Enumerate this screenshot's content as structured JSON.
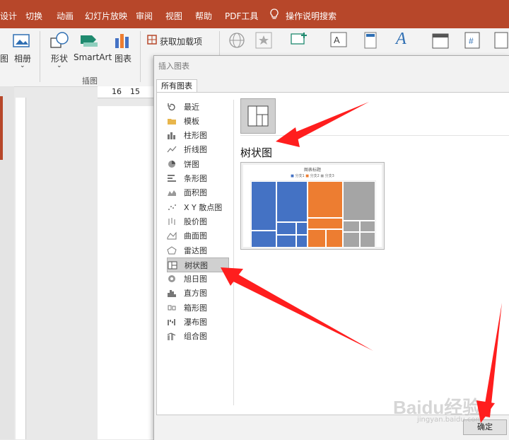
{
  "menubar": {
    "items": [
      "设计",
      "切换",
      "动画",
      "幻灯片放映",
      "审阅",
      "视图",
      "帮助",
      "PDF工具",
      "操作说明搜索"
    ]
  },
  "ribbon": {
    "buttons": {
      "images_partial": "图",
      "album": "相册",
      "shapes": "形状",
      "smartart": "SmartArt",
      "chart": "图表",
      "get_addins": "获取加载项"
    },
    "group_label": "插图"
  },
  "ruler": {
    "top_numbers": [
      "16",
      "15"
    ]
  },
  "dialog": {
    "title": "插入图表",
    "tab": "所有图表",
    "chart_types": [
      {
        "label": "最近",
        "icon": "recent-icon"
      },
      {
        "label": "模板",
        "icon": "folder-icon"
      },
      {
        "label": "柱形图",
        "icon": "column-chart-icon"
      },
      {
        "label": "折线图",
        "icon": "line-chart-icon"
      },
      {
        "label": "饼图",
        "icon": "pie-chart-icon"
      },
      {
        "label": "条形图",
        "icon": "bar-chart-icon"
      },
      {
        "label": "面积图",
        "icon": "area-chart-icon"
      },
      {
        "label": "X Y 散点图",
        "icon": "scatter-chart-icon"
      },
      {
        "label": "股价图",
        "icon": "stock-chart-icon"
      },
      {
        "label": "曲面图",
        "icon": "surface-chart-icon"
      },
      {
        "label": "雷达图",
        "icon": "radar-chart-icon"
      },
      {
        "label": "树状图",
        "icon": "treemap-icon"
      },
      {
        "label": "旭日图",
        "icon": "sunburst-icon"
      },
      {
        "label": "直方图",
        "icon": "histogram-icon"
      },
      {
        "label": "箱形图",
        "icon": "boxplot-icon"
      },
      {
        "label": "瀑布图",
        "icon": "waterfall-icon"
      },
      {
        "label": "组合图",
        "icon": "combo-chart-icon"
      }
    ],
    "selected_index": 11,
    "selected_title": "树状图",
    "preview": {
      "chart_title": "图表标题",
      "legend": [
        "分支1",
        "分支2",
        "分支3"
      ],
      "colors": {
        "branch1": "#4472c4",
        "branch2": "#ed7d31",
        "branch3": "#a5a5a5"
      }
    },
    "ok_label": "确定"
  },
  "watermark": {
    "brand": "Baidu经验",
    "url": "jingyan.baidu.com"
  }
}
